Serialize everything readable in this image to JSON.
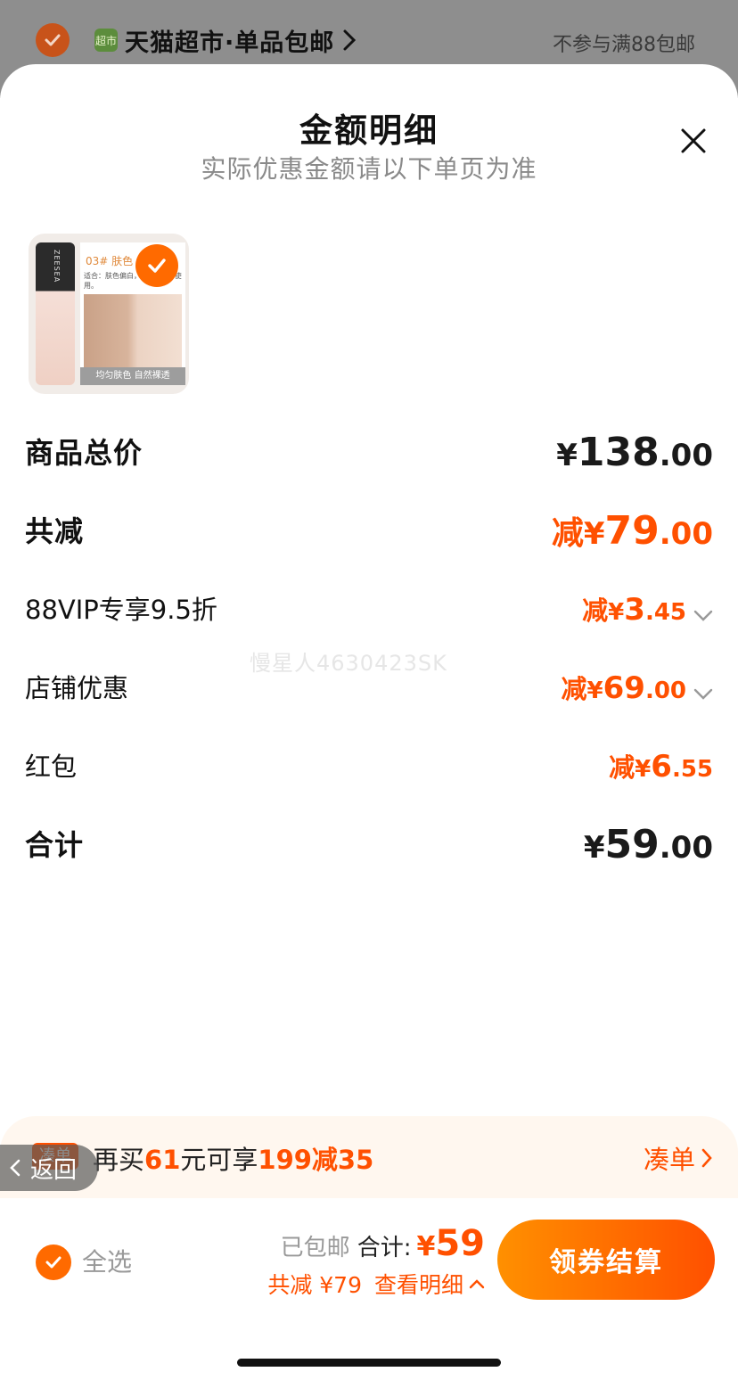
{
  "background_store": {
    "shop_logo_text": "超市",
    "shop_name": "天猫超市·单品包邮",
    "shipping_note": "不参与满88包邮"
  },
  "sheet": {
    "title": "金额明细",
    "subtitle": "实际优惠金额请以下单页为准"
  },
  "product": {
    "brand_text": "ZEESEA",
    "shade": "03# 肤色",
    "desc": "适合：肤色偏白，实…的MM使用。",
    "caption": "均匀肤色 自然裸透"
  },
  "breakdown": {
    "subtotal": {
      "label": "商品总价",
      "currency": "¥",
      "int": "138",
      "dec": ".00"
    },
    "total_discount": {
      "label": "共减",
      "prefix": "减",
      "currency": "¥",
      "int": "79",
      "dec": ".00"
    },
    "vip": {
      "label": "88VIP专享9.5折",
      "prefix": "减",
      "currency": "¥",
      "int": "3",
      "dec": ".45"
    },
    "store": {
      "label": "店铺优惠",
      "prefix": "减",
      "currency": "¥",
      "int": "69",
      "dec": ".00"
    },
    "redpacket": {
      "label": "红包",
      "prefix": "减",
      "currency": "¥",
      "int": "6",
      "dec": ".55"
    },
    "total": {
      "label": "合计",
      "currency": "¥",
      "int": "59",
      "dec": ".00"
    }
  },
  "watermark": "慢星人4630423SK",
  "promo": {
    "tag": "凑单",
    "text_pre": "再买",
    "amount": "61",
    "text_mid": "元可享",
    "deal": "199减35",
    "link": "凑单"
  },
  "back_button": "返回",
  "bottom_bar": {
    "select_all": "全选",
    "shipping": "已包邮",
    "total_label": "合计:",
    "currency": "¥",
    "total_value": "59",
    "saved": "共减 ¥79",
    "view_detail": "查看明细",
    "checkout": "领券结算"
  },
  "colors": {
    "accent": "#ff5000",
    "button_start": "#ff9000",
    "promo_bg": "#fff7ef",
    "overlay": "#8e8e8e"
  }
}
